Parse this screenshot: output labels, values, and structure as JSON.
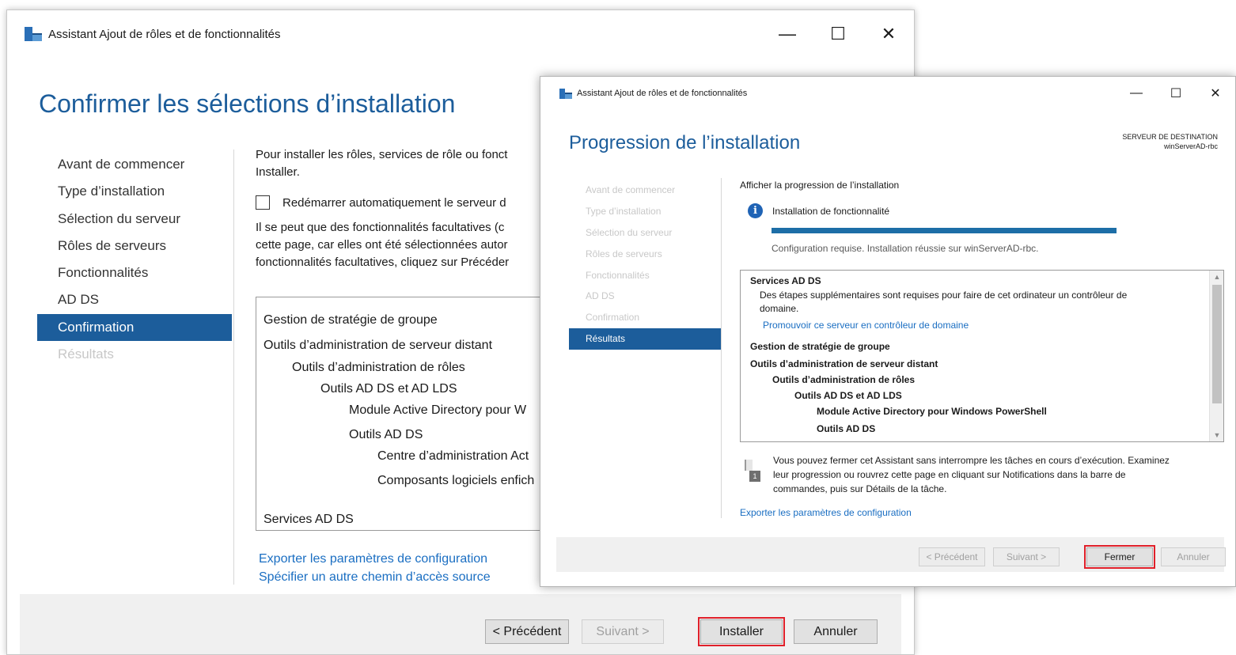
{
  "win1": {
    "title": "Assistant Ajout de rôles et de fonctionnalités",
    "controls": {
      "minimize": "—",
      "maximize": "☐",
      "close": "✕"
    },
    "page_title": "Confirmer les sélections d’installation",
    "nav": [
      {
        "label": "Avant de commencer"
      },
      {
        "label": "Type d’installation"
      },
      {
        "label": "Sélection du serveur"
      },
      {
        "label": "Rôles de serveurs"
      },
      {
        "label": "Fonctionnalités"
      },
      {
        "label": "AD DS"
      },
      {
        "label": "Confirmation"
      },
      {
        "label": "Résultats"
      }
    ],
    "intro_line1": "Pour installer les rôles, services de rôle ou fonct",
    "intro_line2": "Installer.",
    "restart_checkbox_label": "Redémarrer automatiquement le serveur d",
    "para2_line1": "Il se peut que des fonctionnalités facultatives (c",
    "para2_line2": "cette page, car elles ont été sélectionnées autor",
    "para2_line3": "fonctionnalités facultatives, cliquez sur Précéder",
    "selections": [
      "Gestion de stratégie de groupe",
      "Outils d’administration de serveur distant",
      "Outils d’administration de rôles",
      "Outils AD DS et AD LDS",
      "Module Active Directory pour W",
      "Outils AD DS",
      "Centre d’administration Act",
      "Composants logiciels enfich",
      "Services AD DS"
    ],
    "links": {
      "export": "Exporter les paramètres de configuration",
      "source": "Spécifier un autre chemin d’accès source"
    },
    "buttons": {
      "previous": "< Précédent",
      "next": "Suivant >",
      "install": "Installer",
      "cancel": "Annuler"
    }
  },
  "win2": {
    "title": "Assistant Ajout de rôles et de fonctionnalités",
    "controls": {
      "minimize": "—",
      "maximize": "☐",
      "close": "✕"
    },
    "page_title": "Progression de l’installation",
    "destination_label": "SERVEUR DE DESTINATION",
    "destination_server": "winServerAD-rbc",
    "nav": [
      {
        "label": "Avant de commencer"
      },
      {
        "label": "Type d’installation"
      },
      {
        "label": "Sélection du serveur"
      },
      {
        "label": "Rôles de serveurs"
      },
      {
        "label": "Fonctionnalités"
      },
      {
        "label": "AD DS"
      },
      {
        "label": "Confirmation"
      },
      {
        "label": "Résultats"
      }
    ],
    "progress_heading": "Afficher la progression de l’installation",
    "info_glyph": "i",
    "progress_status": "Installation de fonctionnalité",
    "progress_fraction": 1.0,
    "progress_message": "Configuration requise. Installation réussie sur winServerAD-rbc.",
    "results": {
      "services_title": "Services AD DS",
      "services_desc_line1": "Des étapes supplémentaires sont requises pour faire de cet ordinateur un contrôleur de",
      "services_desc_line2": "domaine.",
      "promote_link": "Promouvoir ce serveur en contrôleur de domaine",
      "gpo": "Gestion de stratégie de groupe",
      "rsat": "Outils d’administration de serveur distant",
      "role_tools": "Outils d’administration de rôles",
      "adds_adlds": "Outils AD DS et AD LDS",
      "ps_module": "Module Active Directory pour Windows PowerShell",
      "adds_tools": "Outils AD DS"
    },
    "notice_line1": "Vous pouvez fermer cet Assistant sans interrompre les tâches en cours d’exécution. Examinez",
    "notice_line2": "leur progression ou rouvrez cette page en cliquant sur Notifications dans la barre de",
    "notice_line3": "commandes, puis sur Détails de la tâche.",
    "export_link": "Exporter les paramètres de configuration",
    "buttons": {
      "previous": "< Précédent",
      "next": "Suivant >",
      "close": "Fermer",
      "cancel": "Annuler"
    }
  }
}
